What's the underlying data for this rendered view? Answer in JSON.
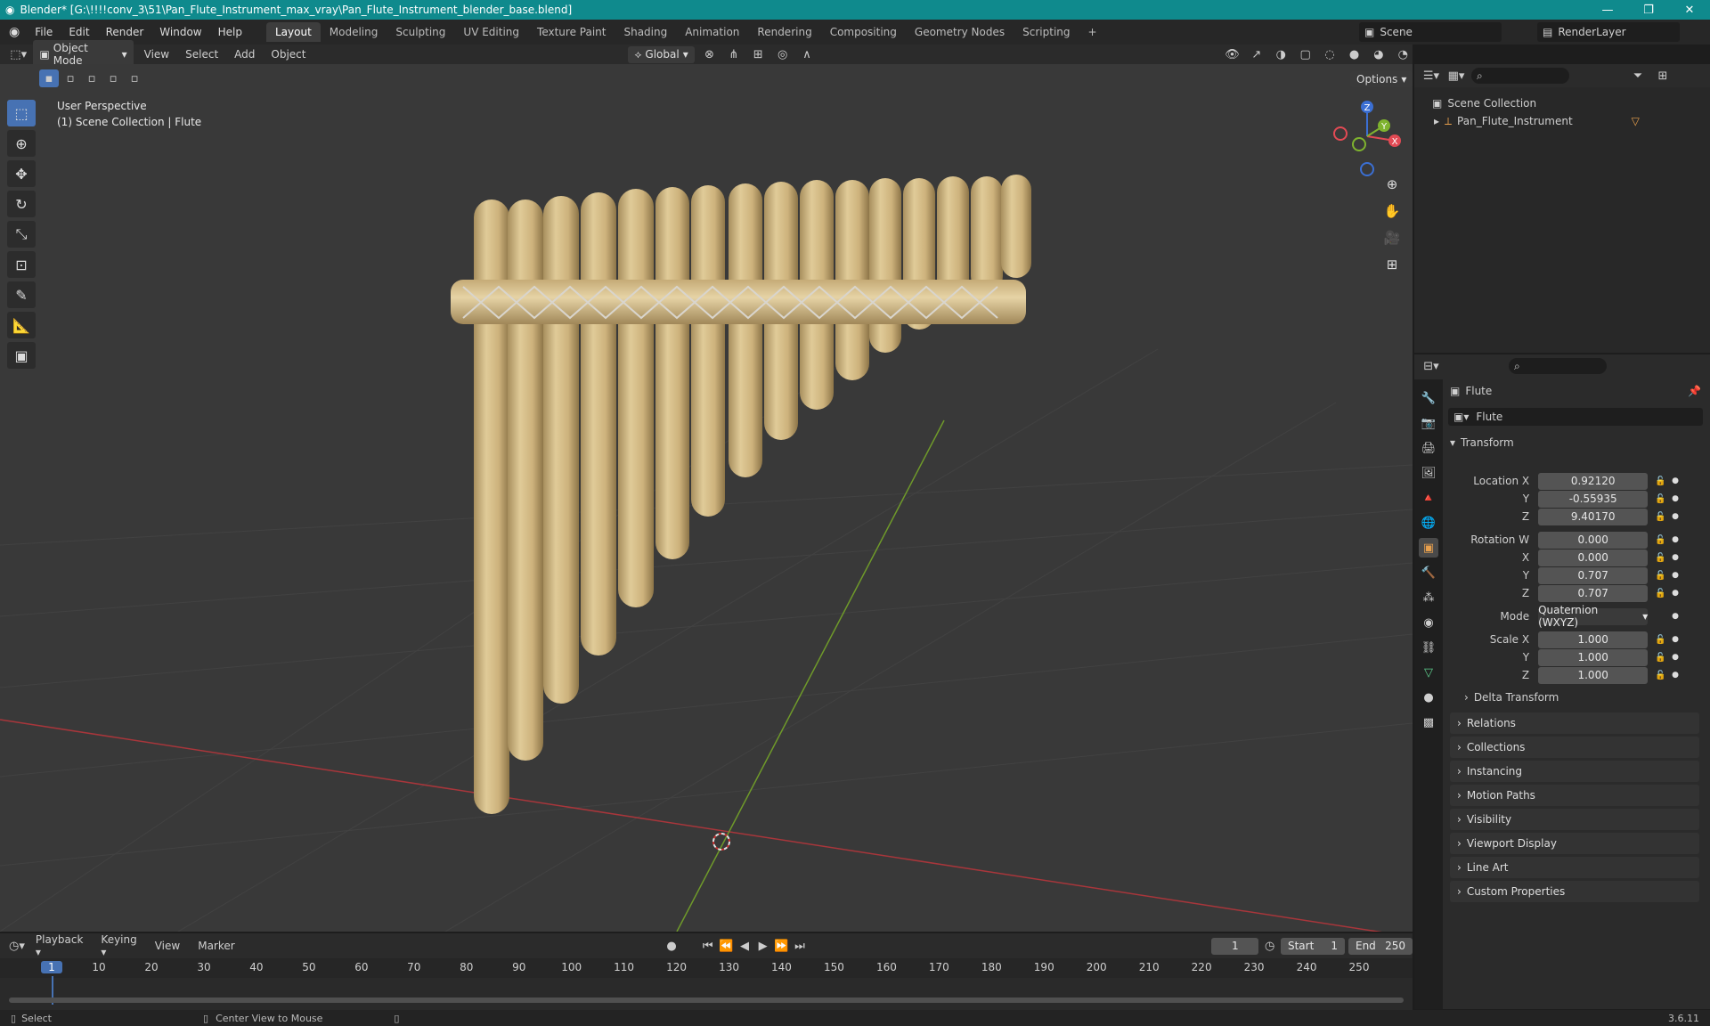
{
  "window": {
    "title": "Blender* [G:\\!!!!conv_3\\51\\Pan_Flute_Instrument_max_vray\\Pan_Flute_Instrument_blender_base.blend]"
  },
  "menu": {
    "items": [
      "File",
      "Edit",
      "Render",
      "Window",
      "Help"
    ],
    "workspaces": [
      "Layout",
      "Modeling",
      "Sculpting",
      "UV Editing",
      "Texture Paint",
      "Shading",
      "Animation",
      "Rendering",
      "Compositing",
      "Geometry Nodes",
      "Scripting"
    ],
    "active_workspace": "Layout",
    "scene": "Scene",
    "view_layer": "RenderLayer"
  },
  "viewport_header": {
    "mode": "Object Mode",
    "menus": [
      "View",
      "Select",
      "Add",
      "Object"
    ],
    "orientation": "Global",
    "options": "Options"
  },
  "viewport": {
    "perspective": "User Perspective",
    "collection_info": "(1) Scene Collection | Flute",
    "axis_labels": {
      "x": "X",
      "y": "Y",
      "z": "Z"
    }
  },
  "outliner": {
    "root": "Scene Collection",
    "items": [
      {
        "label": "Pan_Flute_Instrument"
      }
    ]
  },
  "properties": {
    "object_name": "Flute",
    "data_name": "Flute",
    "transform_label": "Transform",
    "location": {
      "label": "Location X",
      "x": "0.92120",
      "y": "-0.55935",
      "z": "9.40170"
    },
    "rotation": {
      "label": "Rotation W",
      "w": "0.000",
      "x": "0.000",
      "y": "0.707",
      "z": "0.707"
    },
    "mode": {
      "label": "Mode",
      "value": "Quaternion (WXYZ)"
    },
    "scale": {
      "label": "Scale X",
      "x": "1.000",
      "y": "1.000",
      "z": "1.000"
    },
    "axis_y": "Y",
    "axis_z": "Z",
    "axis_x": "X",
    "delta": "Delta Transform",
    "sections": [
      "Relations",
      "Collections",
      "Instancing",
      "Motion Paths",
      "Visibility",
      "Viewport Display",
      "Line Art",
      "Custom Properties"
    ]
  },
  "timeline": {
    "menus": [
      "Playback",
      "Keying",
      "View",
      "Marker"
    ],
    "current_frame": "1",
    "start_label": "Start",
    "start": "1",
    "end_label": "End",
    "end": "250",
    "ticks": [
      "1",
      "10",
      "20",
      "30",
      "40",
      "50",
      "60",
      "70",
      "80",
      "90",
      "100",
      "110",
      "120",
      "130",
      "140",
      "150",
      "160",
      "170",
      "180",
      "190",
      "200",
      "210",
      "220",
      "230",
      "240",
      "250"
    ]
  },
  "status": {
    "select": "Select",
    "center": "Center View to Mouse",
    "version": "3.6.11"
  }
}
